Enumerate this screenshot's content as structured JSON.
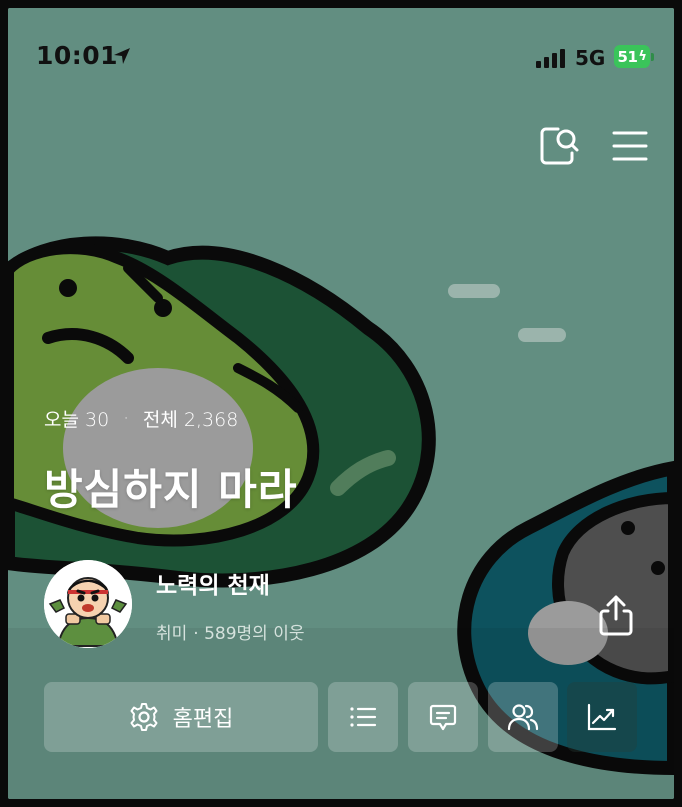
{
  "status_bar": {
    "time": "10:01",
    "network": "5G",
    "battery": "51"
  },
  "header": {
    "search_icon": "search-icon",
    "menu_icon": "hamburger-menu-icon"
  },
  "blog": {
    "today_label": "오늘 30",
    "separator": "·",
    "total_label": "전체 2,368",
    "title": "방심하지 마라",
    "nickname": "노력의 천재",
    "category": "취미",
    "neighbors": "· 589명의 이웃"
  },
  "actions": {
    "edit_home_label": "홈편집",
    "icons": [
      "gear-icon",
      "list-icon",
      "comment-icon",
      "neighbors-icon",
      "stats-chart-icon"
    ]
  },
  "colors": {
    "background": "#6b9b8d",
    "battery": "#3ac45a"
  }
}
